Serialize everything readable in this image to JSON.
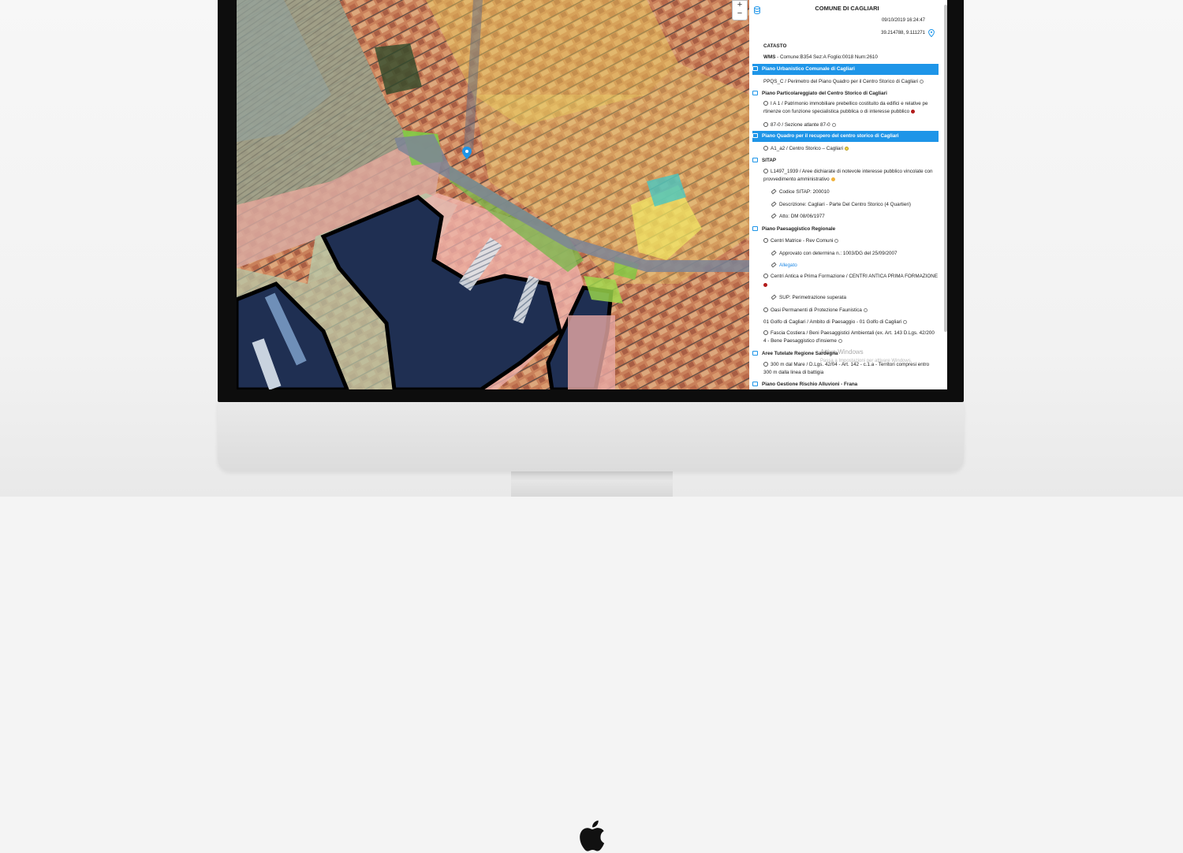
{
  "panel": {
    "title": "COMUNE DI CAGLIARI",
    "date": "09/10/2019 16:24:47",
    "coords": "39.214788, 9.111271",
    "catasto_header": "CATASTO",
    "wms_label": "WMS",
    "wms_value": " - Comune:B354 Sez:A Foglio:0018 Num:2610",
    "puc_header": "Piano Urbanistico Comunale di Cagliari",
    "puc_item": "PPQS_C / Perimetro del Piano Quadro per il Centro Storico di Cagliari",
    "ppcs_header": "Piano Particolareggiato del Centro Storico di Cagliari",
    "ppcs_item1_line1": "I A 1 / Patrimonio immobiliare prebellico costituito da edifici e relative pe",
    "ppcs_item1_line2": "rtinenze con funzione specialistica pubblica o di interesse pubblico",
    "ppcs_item2": "87-0 / Sezione atlante 87-0",
    "pq_header": "Piano Quadro per il recupero del centro storico di Cagliari",
    "pq_item": "A1_a2 / Centro Storico – Cagliari",
    "sitap_header": "SITAP",
    "sitap_item_line1": "L1497_1939 / Aree dichiarate di notevole interesse pubblico vincolate con",
    "sitap_item_line2": "provvedimento amministrativo",
    "sitap_code": "Codice SITAP: 200010",
    "sitap_desc": "Descrizione: Cagliari - Parte Del Centro Storico (4 Quartieri)",
    "sitap_atto": "Atto: DM 08/06/1977",
    "ppr_header": "Piano Paesaggistico Regionale",
    "ppr_item1": "Centri Matrice - Rev Comuni",
    "ppr_item1_approved": "Approvato con determina n.: 1003/DG del 25/09/2007",
    "ppr_item1_link": "Allegato",
    "ppr_item2": "Centri Antica e Prima Formazione / CENTRI ANTICA PRIMA FORMAZIONE",
    "ppr_item2_sup": "SUP: Perimetrazione superata",
    "ppr_item3": "Oasi Permanenti di Protezione Faunistica",
    "ppr_item4": "01 Golfo di Cagliari / Ambito di Paesaggio - 01 Golfo di Cagliari",
    "ppr_item5_line1": "Fascia Costiera / Beni Paesaggistici Ambientali (ex. Art. 143 D.Lgs. 42/200",
    "ppr_item5_line2": "4 - Bene Paesaggistico d'insieme",
    "atrs_header": "Aree Tutelate Regione Sardegna",
    "atrs_item_line1": "300 m dal Mare / D.Lgs. 42/04 - Art. 142 - c.1.a - Territori compresi entro",
    "atrs_item_line2": "300 m dalla linea di battigia",
    "pgra_header": "Piano Gestione Rischio Alluvioni - Frana",
    "watermark_title": "Attiva Windows",
    "watermark_sub": "Passa a Impostazioni per attivare Windows."
  },
  "map": {
    "zoom_in": "+",
    "zoom_out": "−"
  },
  "colors": {
    "accent": "#1e95e8",
    "link": "#1e88e5",
    "sea": "#1f2f52",
    "dot_red": "#b21b1b",
    "dot_yellow": "#f3d64b"
  }
}
